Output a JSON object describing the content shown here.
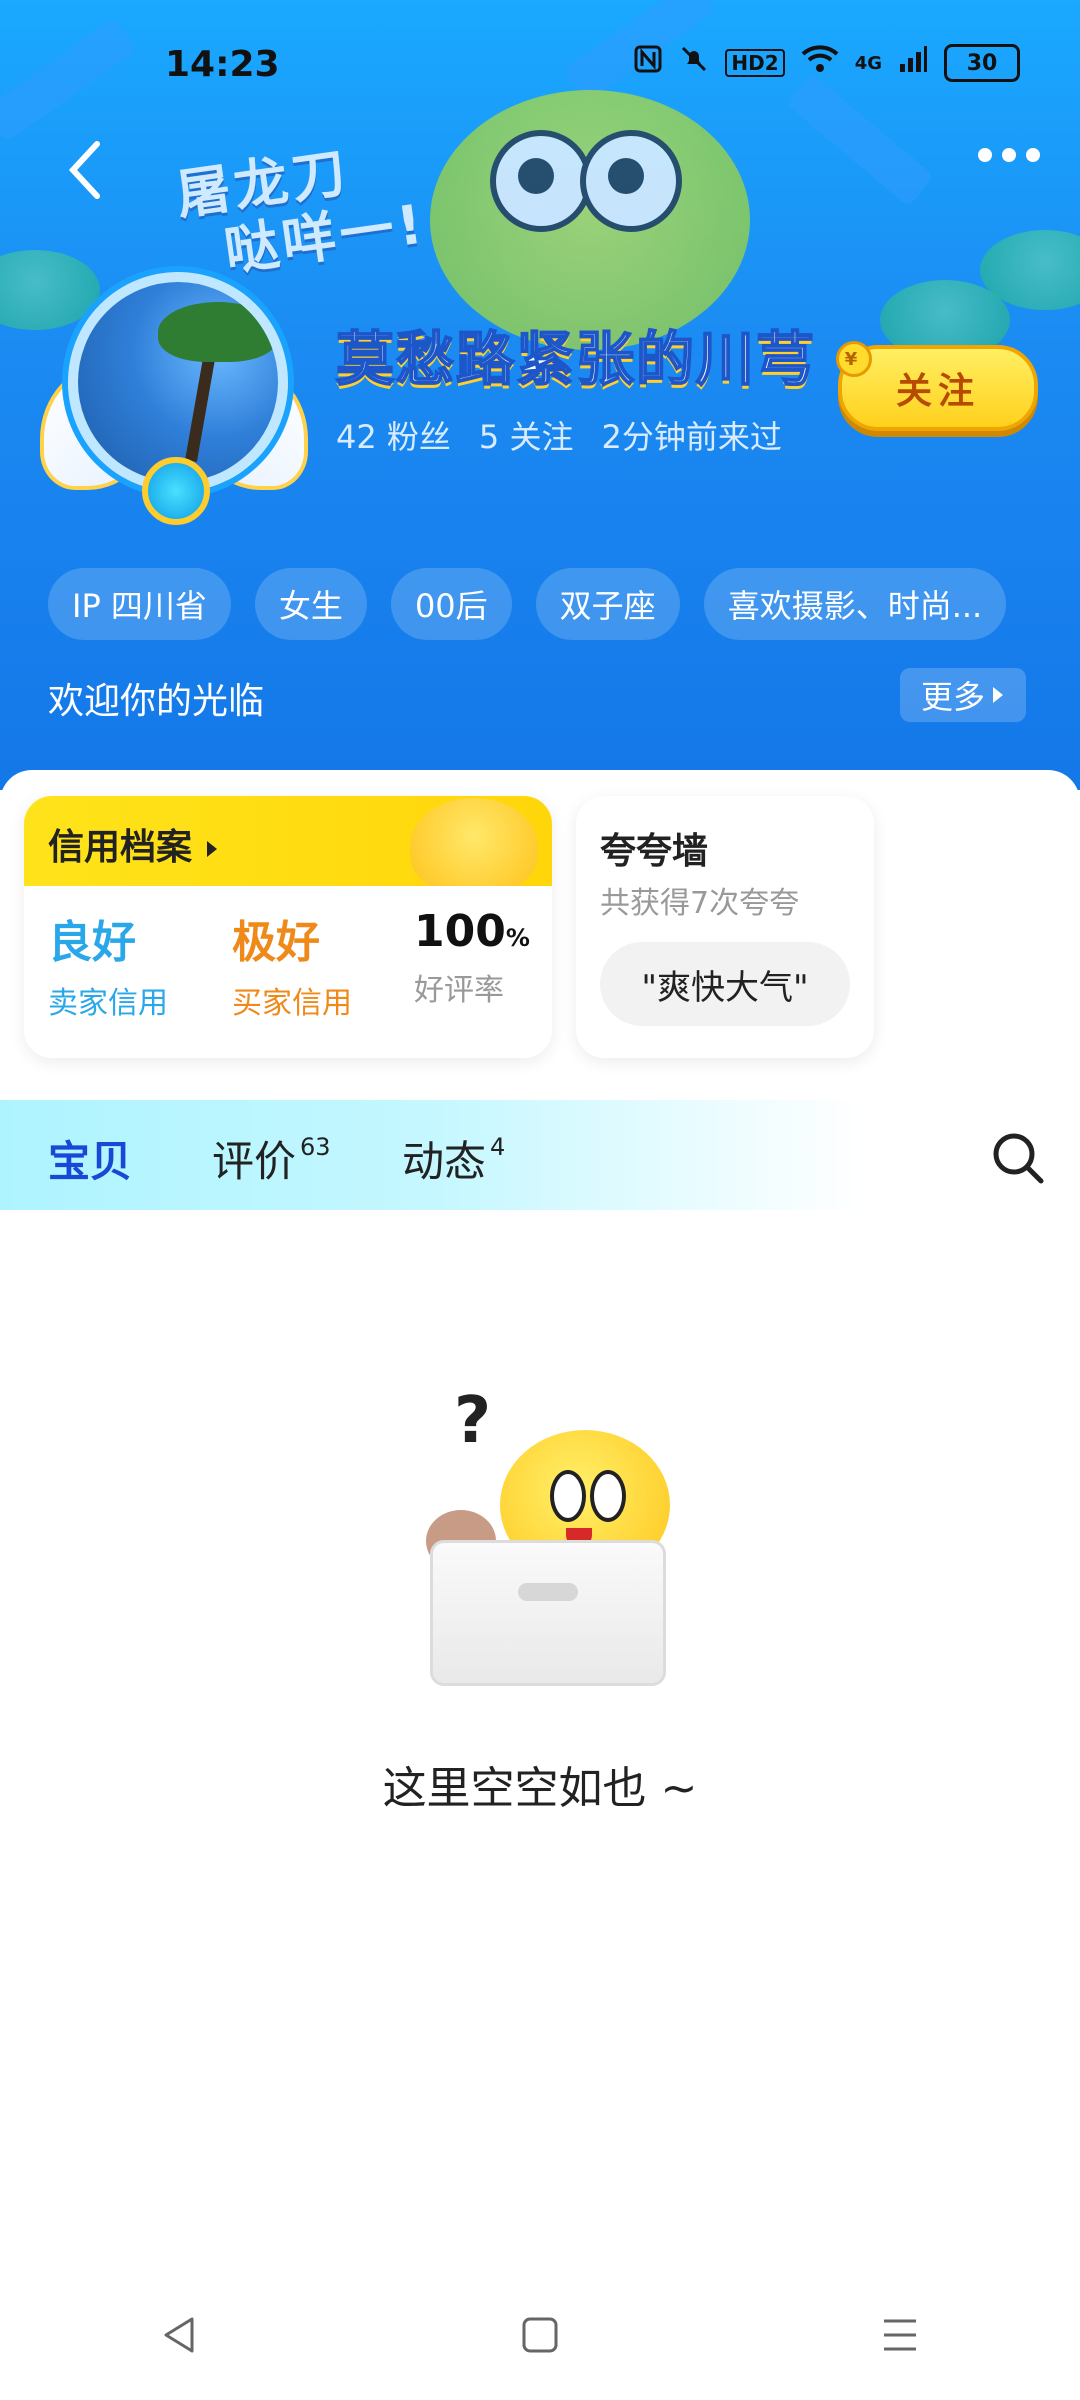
{
  "status_bar": {
    "time": "14:23",
    "network_label": "4G",
    "hd_label": "HD2",
    "battery": "30"
  },
  "header": {
    "banner_line1": "屠龙刀",
    "banner_line2": "哒咩一!",
    "nickname": "莫愁路紧张的川芎",
    "fans": "42 粉丝",
    "following": "5 关注",
    "last_seen": "2分钟前来过",
    "follow_label": "关注",
    "follow_badge": "¥",
    "tags": [
      "IP 四川省",
      "女生",
      "00后",
      "双子座",
      "喜欢摄影、时尚..."
    ],
    "welcome": "欢迎你的光临",
    "more_label": "更多"
  },
  "credit": {
    "title": "信用档案",
    "seller_value": "良好",
    "seller_label": "卖家信用",
    "buyer_value": "极好",
    "buyer_label": "买家信用",
    "rating_value": "100",
    "rating_unit": "%",
    "rating_label": "好评率",
    "colors": {
      "seller": "#2aa7e8",
      "buyer": "#ef8a1a"
    }
  },
  "praise": {
    "title": "夸夸墙",
    "subtitle": "共获得7次夸夸",
    "chip": "\"爽快大气\""
  },
  "tabs": [
    {
      "label": "宝贝",
      "count": ""
    },
    {
      "label": "评价",
      "count": "63"
    },
    {
      "label": "动态",
      "count": "4"
    }
  ],
  "empty_state": {
    "text": "这里空空如也 ~",
    "qmark": "?"
  },
  "icons": [
    "back-arrow-icon",
    "more-dots-icon",
    "search-icon",
    "nav-back-icon",
    "nav-home-icon",
    "nav-menu-icon",
    "nfc-icon",
    "mute-icon",
    "wifi-icon",
    "signal-icon"
  ]
}
